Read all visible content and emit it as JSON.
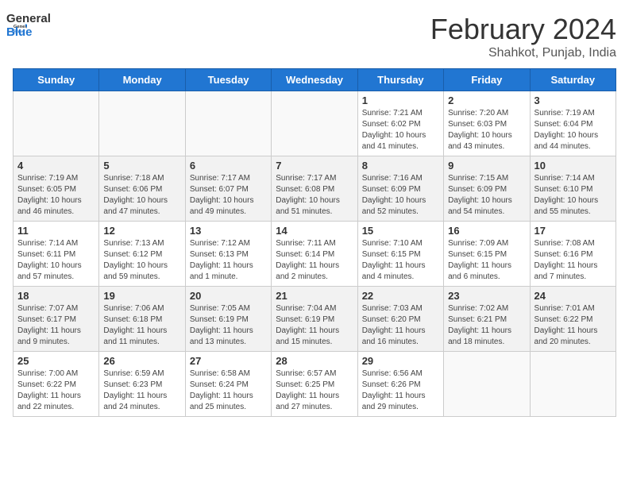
{
  "header": {
    "logo_general": "General",
    "logo_blue": "Blue",
    "title": "February 2024",
    "location": "Shahkot, Punjab, India"
  },
  "weekdays": [
    "Sunday",
    "Monday",
    "Tuesday",
    "Wednesday",
    "Thursday",
    "Friday",
    "Saturday"
  ],
  "weeks": [
    [
      {
        "day": "",
        "info": ""
      },
      {
        "day": "",
        "info": ""
      },
      {
        "day": "",
        "info": ""
      },
      {
        "day": "",
        "info": ""
      },
      {
        "day": "1",
        "info": "Sunrise: 7:21 AM\nSunset: 6:02 PM\nDaylight: 10 hours\nand 41 minutes."
      },
      {
        "day": "2",
        "info": "Sunrise: 7:20 AM\nSunset: 6:03 PM\nDaylight: 10 hours\nand 43 minutes."
      },
      {
        "day": "3",
        "info": "Sunrise: 7:19 AM\nSunset: 6:04 PM\nDaylight: 10 hours\nand 44 minutes."
      }
    ],
    [
      {
        "day": "4",
        "info": "Sunrise: 7:19 AM\nSunset: 6:05 PM\nDaylight: 10 hours\nand 46 minutes."
      },
      {
        "day": "5",
        "info": "Sunrise: 7:18 AM\nSunset: 6:06 PM\nDaylight: 10 hours\nand 47 minutes."
      },
      {
        "day": "6",
        "info": "Sunrise: 7:17 AM\nSunset: 6:07 PM\nDaylight: 10 hours\nand 49 minutes."
      },
      {
        "day": "7",
        "info": "Sunrise: 7:17 AM\nSunset: 6:08 PM\nDaylight: 10 hours\nand 51 minutes."
      },
      {
        "day": "8",
        "info": "Sunrise: 7:16 AM\nSunset: 6:09 PM\nDaylight: 10 hours\nand 52 minutes."
      },
      {
        "day": "9",
        "info": "Sunrise: 7:15 AM\nSunset: 6:09 PM\nDaylight: 10 hours\nand 54 minutes."
      },
      {
        "day": "10",
        "info": "Sunrise: 7:14 AM\nSunset: 6:10 PM\nDaylight: 10 hours\nand 55 minutes."
      }
    ],
    [
      {
        "day": "11",
        "info": "Sunrise: 7:14 AM\nSunset: 6:11 PM\nDaylight: 10 hours\nand 57 minutes."
      },
      {
        "day": "12",
        "info": "Sunrise: 7:13 AM\nSunset: 6:12 PM\nDaylight: 10 hours\nand 59 minutes."
      },
      {
        "day": "13",
        "info": "Sunrise: 7:12 AM\nSunset: 6:13 PM\nDaylight: 11 hours\nand 1 minute."
      },
      {
        "day": "14",
        "info": "Sunrise: 7:11 AM\nSunset: 6:14 PM\nDaylight: 11 hours\nand 2 minutes."
      },
      {
        "day": "15",
        "info": "Sunrise: 7:10 AM\nSunset: 6:15 PM\nDaylight: 11 hours\nand 4 minutes."
      },
      {
        "day": "16",
        "info": "Sunrise: 7:09 AM\nSunset: 6:15 PM\nDaylight: 11 hours\nand 6 minutes."
      },
      {
        "day": "17",
        "info": "Sunrise: 7:08 AM\nSunset: 6:16 PM\nDaylight: 11 hours\nand 7 minutes."
      }
    ],
    [
      {
        "day": "18",
        "info": "Sunrise: 7:07 AM\nSunset: 6:17 PM\nDaylight: 11 hours\nand 9 minutes."
      },
      {
        "day": "19",
        "info": "Sunrise: 7:06 AM\nSunset: 6:18 PM\nDaylight: 11 hours\nand 11 minutes."
      },
      {
        "day": "20",
        "info": "Sunrise: 7:05 AM\nSunset: 6:19 PM\nDaylight: 11 hours\nand 13 minutes."
      },
      {
        "day": "21",
        "info": "Sunrise: 7:04 AM\nSunset: 6:19 PM\nDaylight: 11 hours\nand 15 minutes."
      },
      {
        "day": "22",
        "info": "Sunrise: 7:03 AM\nSunset: 6:20 PM\nDaylight: 11 hours\nand 16 minutes."
      },
      {
        "day": "23",
        "info": "Sunrise: 7:02 AM\nSunset: 6:21 PM\nDaylight: 11 hours\nand 18 minutes."
      },
      {
        "day": "24",
        "info": "Sunrise: 7:01 AM\nSunset: 6:22 PM\nDaylight: 11 hours\nand 20 minutes."
      }
    ],
    [
      {
        "day": "25",
        "info": "Sunrise: 7:00 AM\nSunset: 6:22 PM\nDaylight: 11 hours\nand 22 minutes."
      },
      {
        "day": "26",
        "info": "Sunrise: 6:59 AM\nSunset: 6:23 PM\nDaylight: 11 hours\nand 24 minutes."
      },
      {
        "day": "27",
        "info": "Sunrise: 6:58 AM\nSunset: 6:24 PM\nDaylight: 11 hours\nand 25 minutes."
      },
      {
        "day": "28",
        "info": "Sunrise: 6:57 AM\nSunset: 6:25 PM\nDaylight: 11 hours\nand 27 minutes."
      },
      {
        "day": "29",
        "info": "Sunrise: 6:56 AM\nSunset: 6:26 PM\nDaylight: 11 hours\nand 29 minutes."
      },
      {
        "day": "",
        "info": ""
      },
      {
        "day": "",
        "info": ""
      }
    ]
  ]
}
